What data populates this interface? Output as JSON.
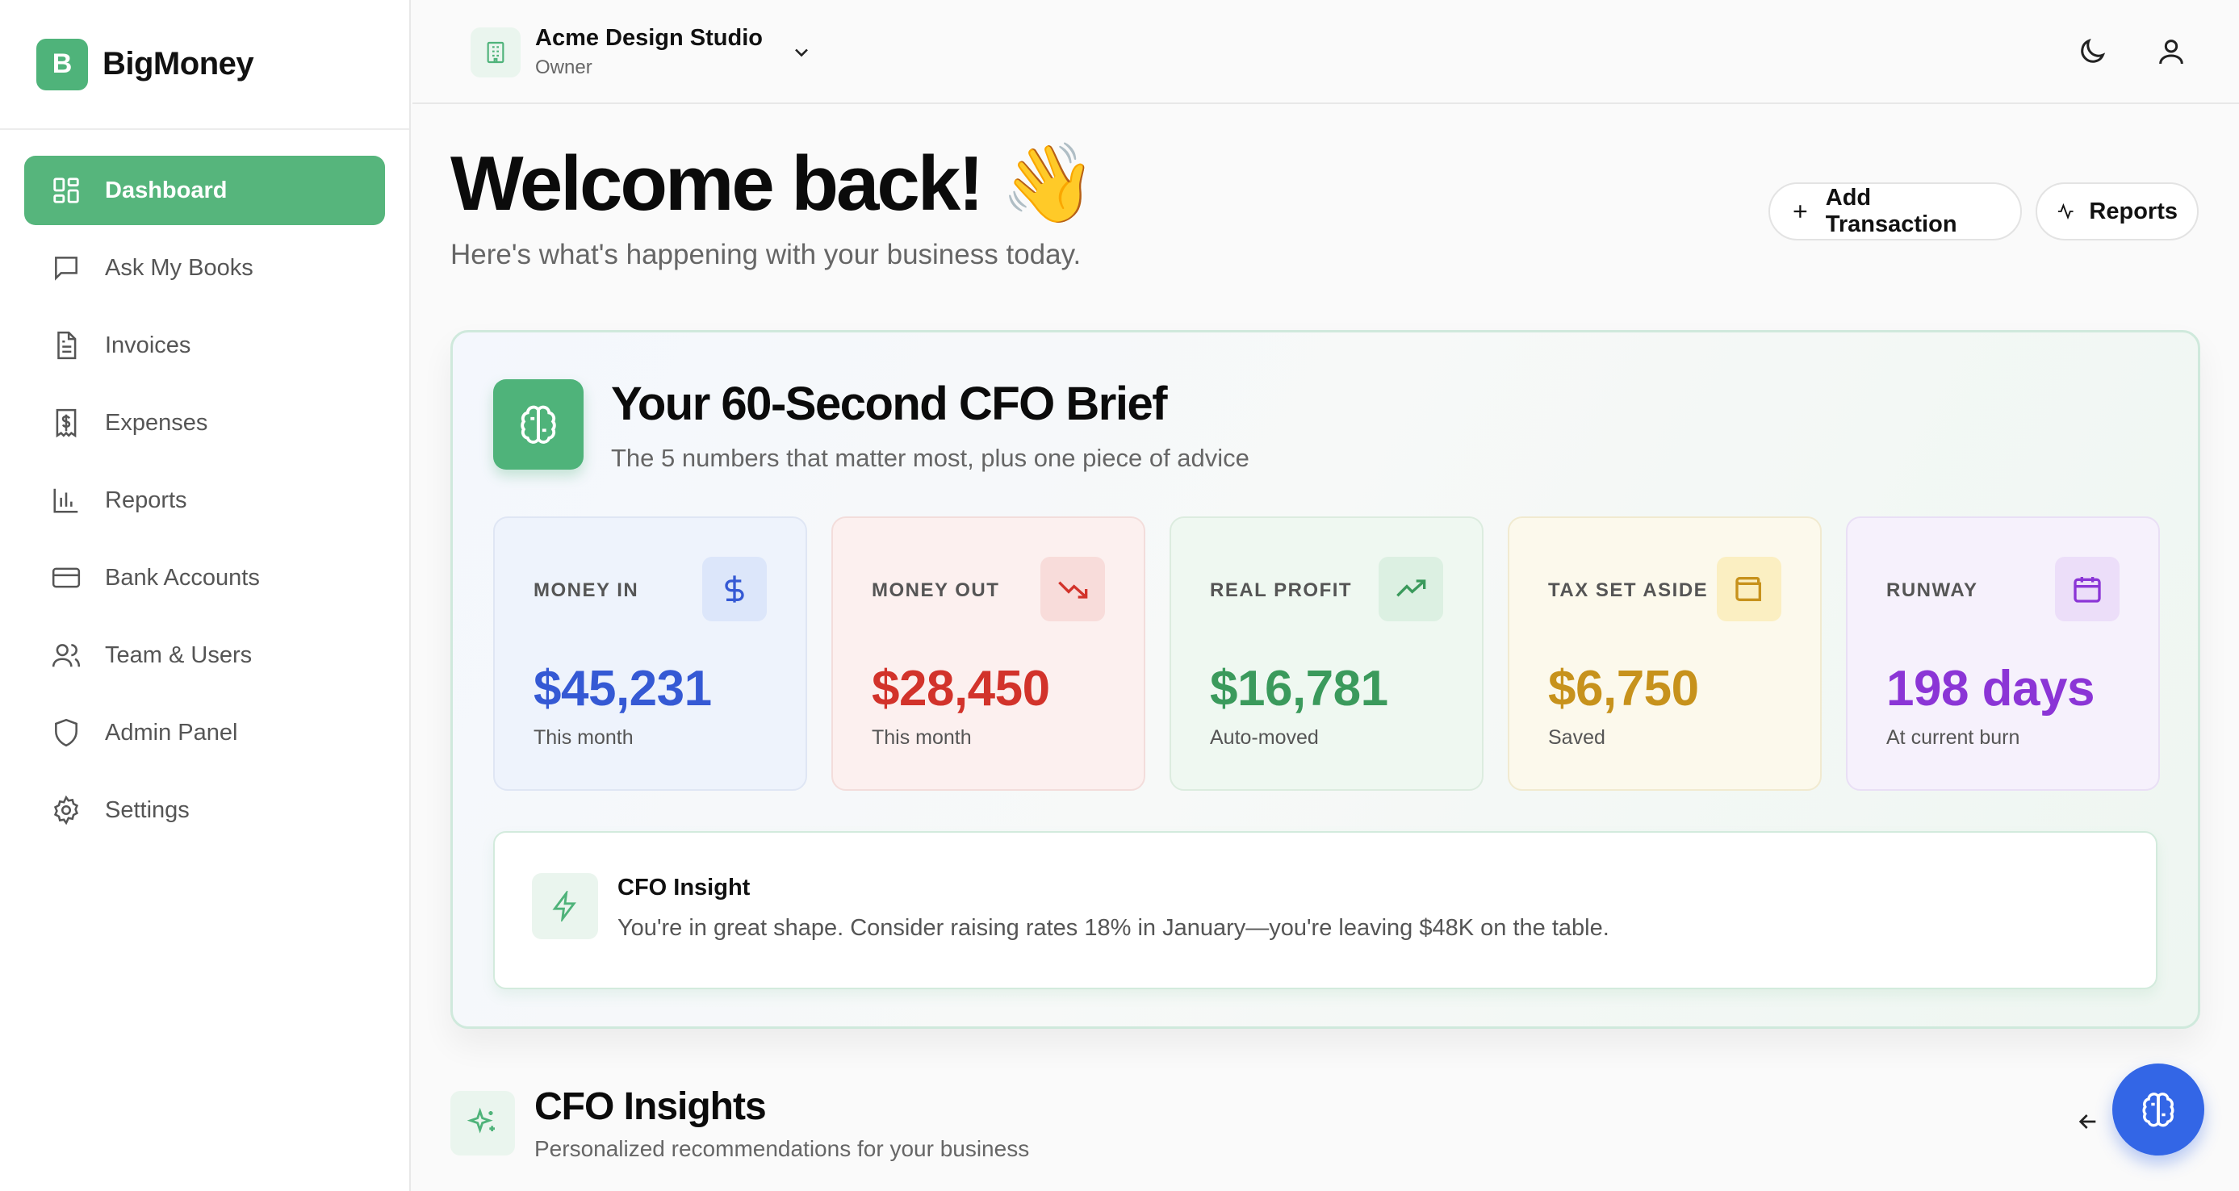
{
  "brand": {
    "logo_letter": "B",
    "name": "BigMoney"
  },
  "sidebar": {
    "items": [
      {
        "label": "Dashboard",
        "icon": "dashboard-icon",
        "active": true
      },
      {
        "label": "Ask My Books",
        "icon": "chat-icon"
      },
      {
        "label": "Invoices",
        "icon": "file-text-icon"
      },
      {
        "label": "Expenses",
        "icon": "receipt-icon"
      },
      {
        "label": "Reports",
        "icon": "bar-chart-icon"
      },
      {
        "label": "Bank Accounts",
        "icon": "credit-card-icon"
      },
      {
        "label": "Team & Users",
        "icon": "users-icon"
      },
      {
        "label": "Admin Panel",
        "icon": "shield-icon"
      },
      {
        "label": "Settings",
        "icon": "gear-icon"
      }
    ]
  },
  "header": {
    "org_name": "Acme Design Studio",
    "org_role": "Owner"
  },
  "welcome": {
    "title": "Welcome back! 👋",
    "subtitle": "Here's what's happening with your business today."
  },
  "actions": {
    "add_transaction": "Add Transaction",
    "reports": "Reports"
  },
  "brief": {
    "title": "Your 60-Second CFO Brief",
    "subtitle": "The 5 numbers that matter most, plus one piece of advice",
    "metrics": [
      {
        "label": "MONEY IN",
        "value": "$45,231",
        "note": "This month",
        "color": "#3559d4",
        "icon": "dollar-icon"
      },
      {
        "label": "MONEY OUT",
        "value": "$28,450",
        "note": "This month",
        "color": "#d2332b",
        "icon": "trending-down-icon"
      },
      {
        "label": "REAL PROFIT",
        "value": "$16,781",
        "note": "Auto-moved",
        "color": "#3b9a5c",
        "icon": "trending-up-icon"
      },
      {
        "label": "TAX SET ASIDE",
        "value": "$6,750",
        "note": "Saved",
        "color": "#c7921c",
        "icon": "wallet-icon"
      },
      {
        "label": "RUNWAY",
        "value": "198 days",
        "note": "At current burn",
        "color": "#8b35d6",
        "icon": "calendar-icon"
      }
    ],
    "insight": {
      "title": "CFO Insight",
      "text": "You're in great shape. Consider raising rates 18% in January—you're leaving $48K on the table."
    }
  },
  "insights_section": {
    "title": "CFO Insights",
    "subtitle": "Personalized recommendations for your business"
  },
  "colors": {
    "accent": "#4fb37a",
    "fab": "#3366e6"
  }
}
